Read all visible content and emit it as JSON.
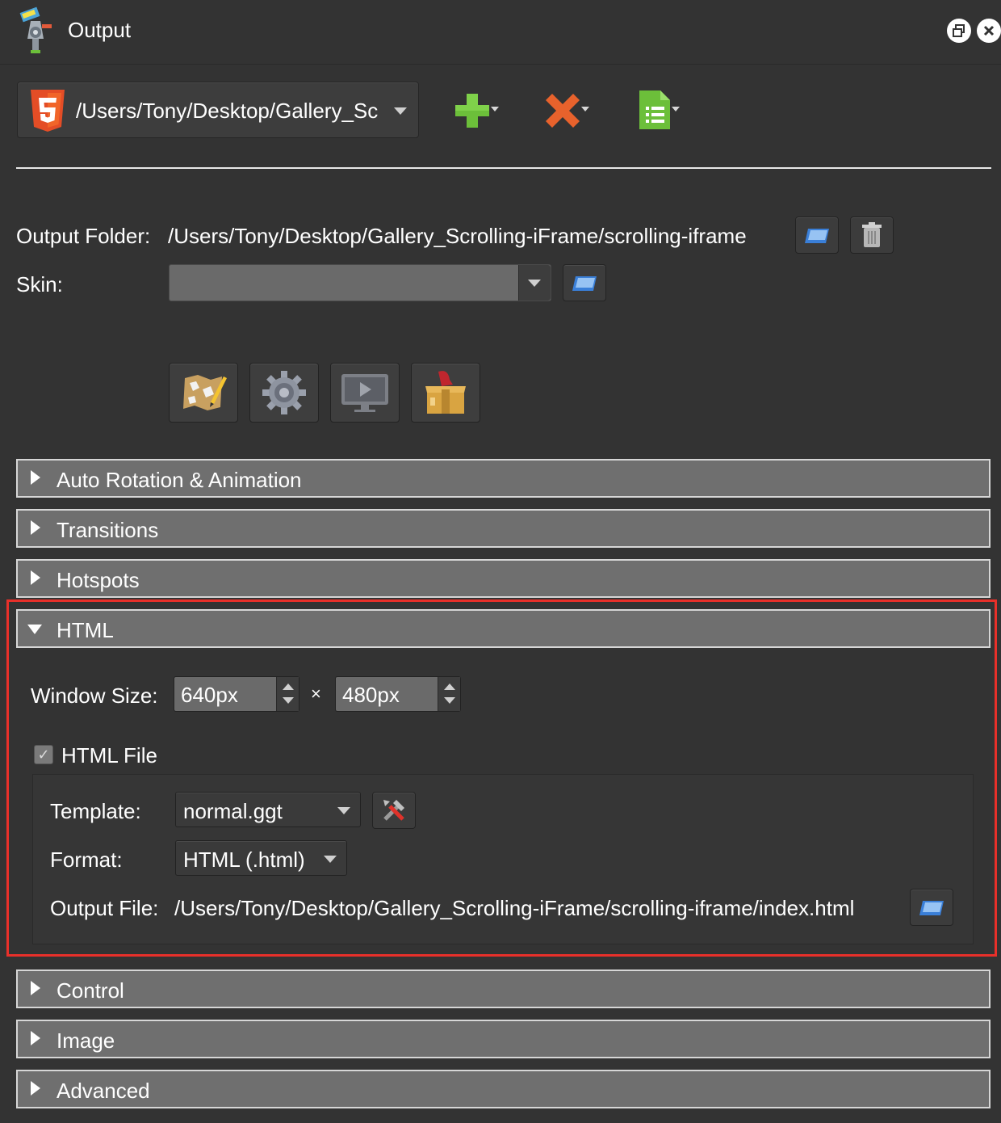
{
  "window": {
    "title": "Output",
    "icons": [
      "app-icon",
      "restore-icon",
      "close-icon"
    ]
  },
  "toolbar": {
    "output_path": "/Users/Tony/Desktop/Gallery_Sc",
    "output_type_icon": "html5-icon",
    "add_icon": "plus-icon",
    "remove_icon": "x-icon",
    "template_icon": "document-icon"
  },
  "settings": {
    "output_folder_label": "Output Folder:",
    "output_folder_value": "/Users/Tony/Desktop/Gallery_Scrolling-iFrame/scrolling-iframe",
    "skin_label": "Skin:",
    "skin_value": "",
    "tool_buttons": [
      "map-icon",
      "gear-icon",
      "preview-icon",
      "package-icon"
    ]
  },
  "sections": [
    {
      "label": "Auto Rotation & Animation",
      "expanded": false
    },
    {
      "label": "Transitions",
      "expanded": false
    },
    {
      "label": "Hotspots",
      "expanded": false
    },
    {
      "label": "HTML",
      "expanded": true
    },
    {
      "label": "Control",
      "expanded": false
    },
    {
      "label": "Image",
      "expanded": false
    },
    {
      "label": "Advanced",
      "expanded": false
    }
  ],
  "html_section": {
    "window_size_label": "Window Size:",
    "width_value": "640px",
    "times": "×",
    "height_value": "480px",
    "html_file_checked": true,
    "html_file_label": "HTML File",
    "check_mark": "✓",
    "template_label": "Template:",
    "template_value": "normal.ggt",
    "format_label": "Format:",
    "format_value": "HTML (.html)",
    "output_file_label": "Output File:",
    "output_file_value": "/Users/Tony/Desktop/Gallery_Scrolling-iFrame/scrolling-iframe/index.html"
  },
  "colors": {
    "background": "#333333",
    "section_header": "#6f6f6f",
    "highlight": "#e8302a",
    "html5_orange": "#e44d26",
    "add_green": "#6cbf3a",
    "remove_orange": "#e8622c"
  }
}
